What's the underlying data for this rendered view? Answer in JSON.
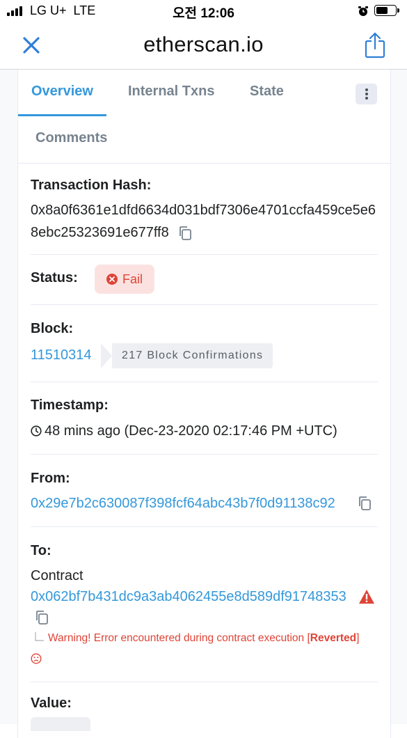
{
  "status_bar": {
    "carrier": "LG U+",
    "network": "LTE",
    "time": "오전 12:06"
  },
  "browser": {
    "url": "etherscan.io",
    "close_icon": "close-icon",
    "share_icon": "share-icon"
  },
  "tabs": [
    {
      "label": "Overview",
      "active": true
    },
    {
      "label": "Internal Txns",
      "active": false
    },
    {
      "label": "State",
      "active": false
    },
    {
      "label": "Comments",
      "active": false
    }
  ],
  "transaction": {
    "hash_label": "Transaction Hash:",
    "hash": "0x8a0f6361e1dfd6634d031bdf7306e4701ccfa459ce5e68ebc25323691e677ff8",
    "status_label": "Status:",
    "status": "Fail",
    "status_color": "#de4437",
    "block_label": "Block:",
    "block": "11510314",
    "block_confirmations": "217 Block Confirmations",
    "timestamp_label": "Timestamp:",
    "timestamp": "48 mins ago (Dec-23-2020 02:17:46 PM +UTC)",
    "from_label": "From:",
    "from": "0x29e7b2c630087f398fcf64abc43b7f0d91138c92",
    "to_label": "To:",
    "to_prefix": "Contract",
    "to": "0x062bf7b431dc9a3ab4062455e8d589df91748353",
    "warning_text": "Warning! Error encountered during contract execution [",
    "warning_bold": "Reverted",
    "warning_close": "]",
    "value_label": "Value:"
  },
  "colors": {
    "accent": "#3498db",
    "danger": "#de4437",
    "muted": "#77838f"
  }
}
